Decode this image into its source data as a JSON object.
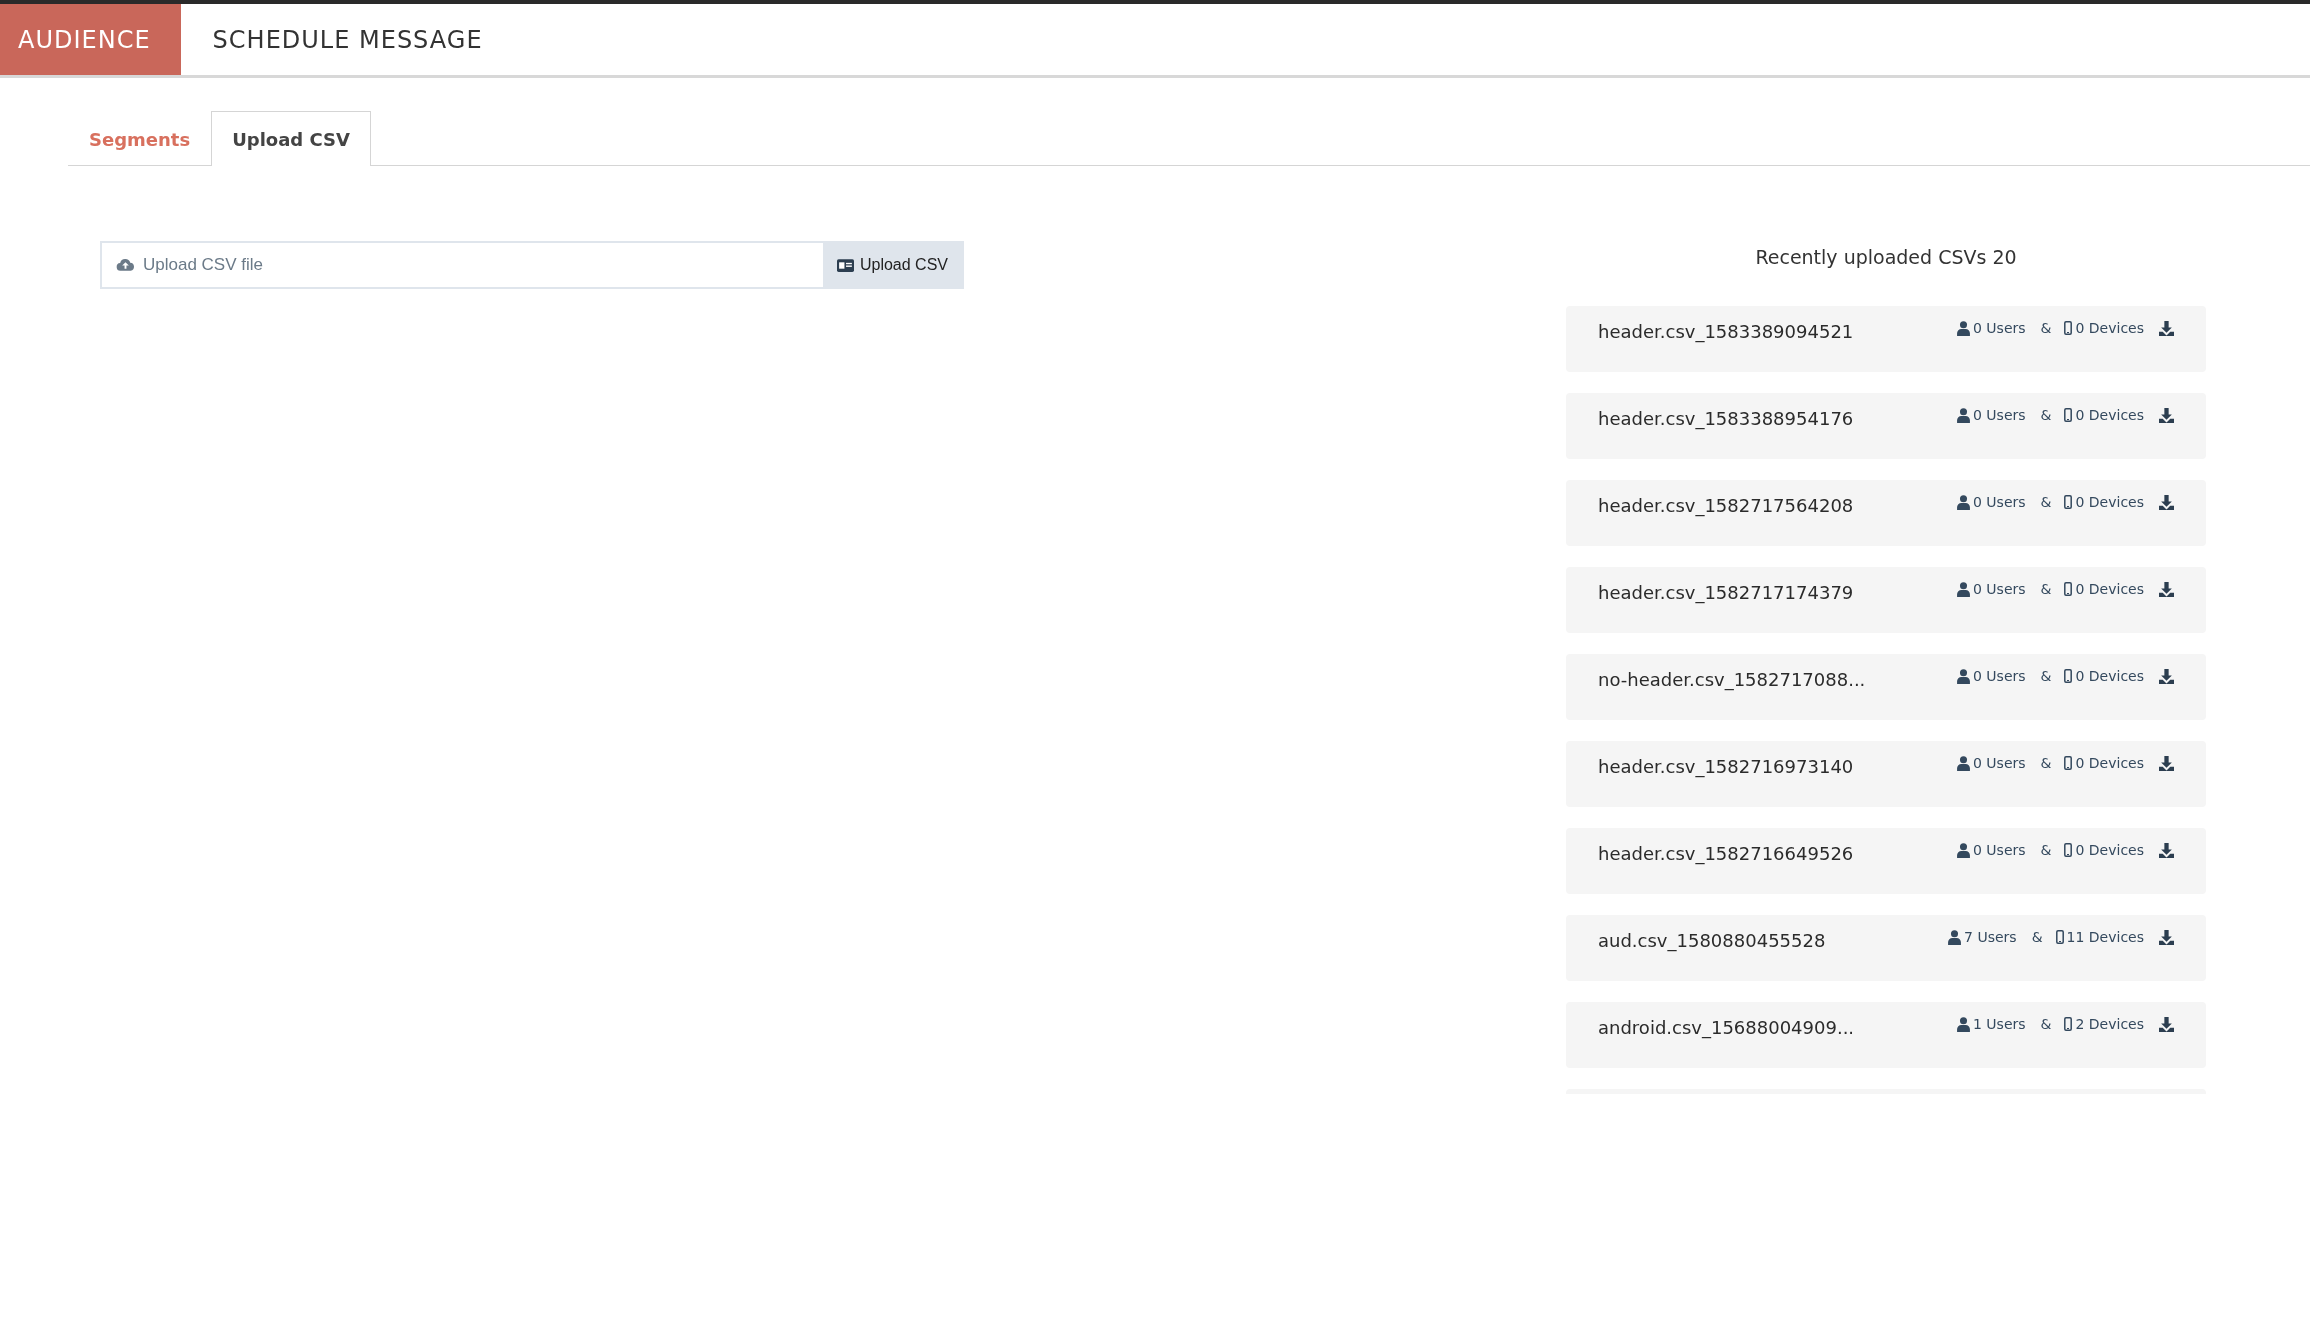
{
  "nav_tabs": [
    {
      "label": "AUDIENCE",
      "selected": true
    },
    {
      "label": "SCHEDULE MESSAGE",
      "selected": false
    }
  ],
  "sub_tabs": [
    {
      "label": "Segments",
      "selected": false
    },
    {
      "label": "Upload CSV",
      "selected": true
    }
  ],
  "upload": {
    "placeholder": "Upload CSV file",
    "button": "Upload CSV"
  },
  "recent": {
    "title": "Recently uploaded CSVs 20",
    "rows": [
      {
        "name": "header.csv_1583389094521",
        "users": "0 Users",
        "amp": "&",
        "devices": "0 Devices"
      },
      {
        "name": "header.csv_1583388954176",
        "users": "0 Users",
        "amp": "&",
        "devices": "0 Devices"
      },
      {
        "name": "header.csv_1582717564208",
        "users": "0 Users",
        "amp": "&",
        "devices": "0 Devices"
      },
      {
        "name": "header.csv_1582717174379",
        "users": "0 Users",
        "amp": "&",
        "devices": "0 Devices"
      },
      {
        "name": "no-header.csv_1582717088...",
        "users": "0 Users",
        "amp": "&",
        "devices": "0 Devices"
      },
      {
        "name": "header.csv_1582716973140",
        "users": "0 Users",
        "amp": "&",
        "devices": "0 Devices"
      },
      {
        "name": "header.csv_1582716649526",
        "users": "0 Users",
        "amp": "&",
        "devices": "0 Devices"
      },
      {
        "name": "aud.csv_1580880455528",
        "users": "7 Users",
        "amp": "&",
        "devices": "11 Devices"
      },
      {
        "name": "android.csv_15688004909...",
        "users": "1 Users",
        "amp": "&",
        "devices": "2 Devices"
      }
    ]
  }
}
